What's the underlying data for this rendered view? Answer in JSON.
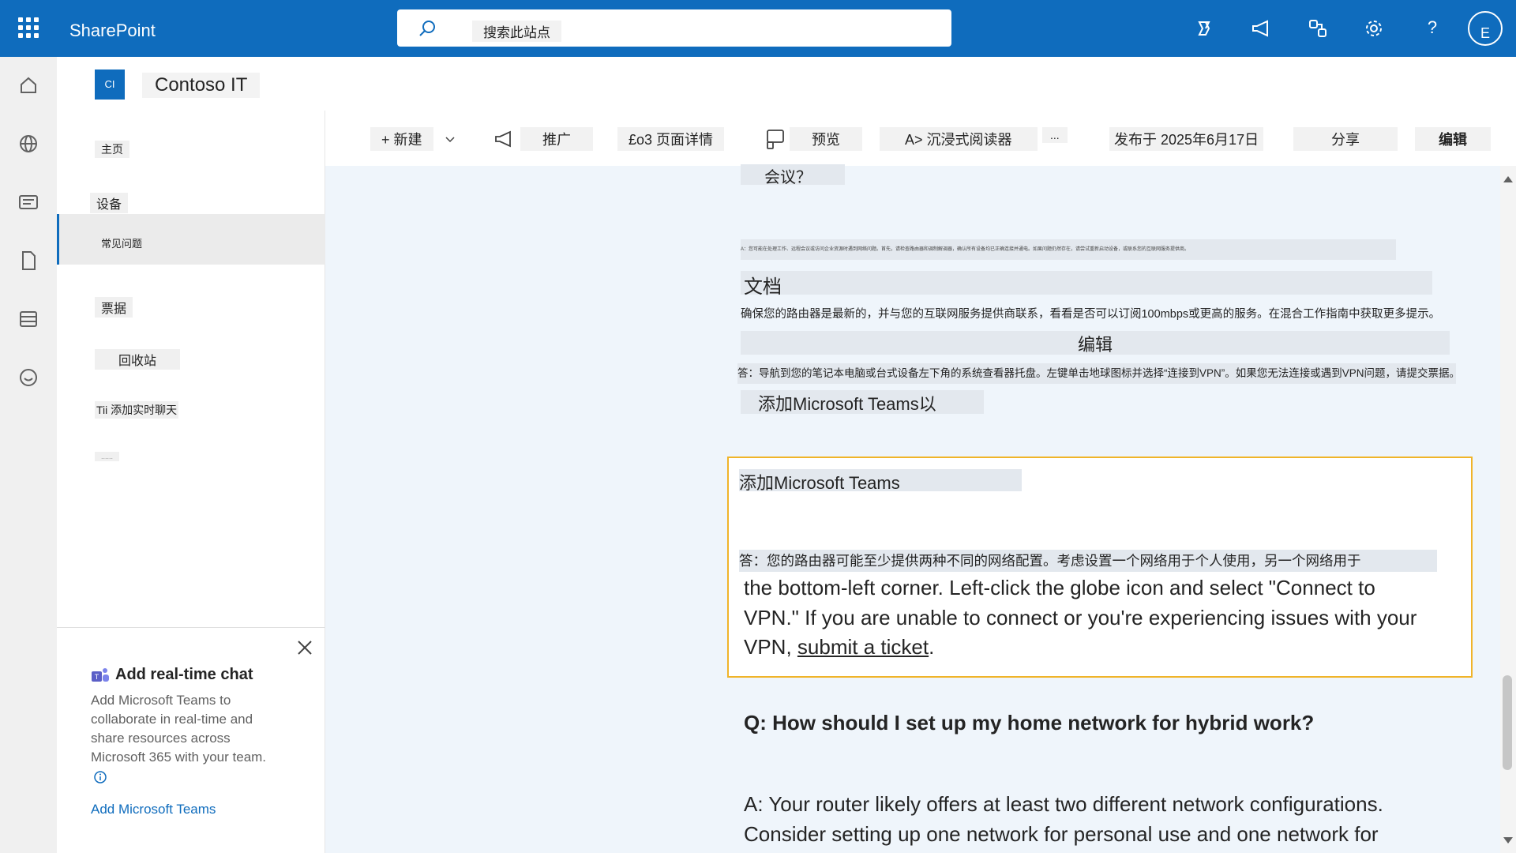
{
  "suitebar": {
    "brand": "SharePoint",
    "search_placeholder": "搜索此站点",
    "avatar_initial": "E",
    "help": "?"
  },
  "site": {
    "logo_text": "CI",
    "name": "Contoso IT"
  },
  "nav": {
    "items": [
      {
        "label": "主页"
      },
      {
        "label": "设备"
      },
      {
        "label": "常见问题"
      },
      {
        "label": "票据"
      },
      {
        "label": "回收站"
      },
      {
        "label": "Tii 添加实时聊天"
      },
      {
        "label": "......"
      }
    ]
  },
  "chat_panel": {
    "title": "Add real-time chat",
    "body": "Add Microsoft Teams to collaborate in real-time and share resources across Microsoft 365 with your team.",
    "link": "Add Microsoft Teams"
  },
  "cmdbar": {
    "new": "+ 新建",
    "promote": "推广",
    "page_details": "£o3 页面详情",
    "preview": "预览",
    "immersive": "A> 沉浸式阅读器",
    "more": "...",
    "published": "发布于 2025年6月17日",
    "share": "分享",
    "edit": "编辑"
  },
  "content": {
    "q_meeting": "会议？",
    "tiny_text": "A：您可能在处理工作、远程会议或访问企业资源时遇到网络问题。首先，请检查路由器和调制解调器，确认所有设备均已正确连接并通电。如果问题仍然存在，请尝试重新启动设备，或联系您的互联网服务提供商。",
    "doc_heading": "文档",
    "router_line": "确保您的路由器是最新的，并与您的互联网服务提供商联系，看看是否可以订阅100mbps或更高的服务。在混合工作指南中获取更多提示。",
    "edit_heading": "编辑",
    "vpn_line": "答：导航到您的笔记本电脑或台式设备左下角的系统查看器托盘。左键单击地球图标并选择“连接到VPN”。如果您无法连接或遇到VPN问题，请提交票据。",
    "add_teams_short": "添加Microsoft Teams以",
    "box_heading": "添加Microsoft Teams",
    "box_zh": "答：您的路由器可能至少提供两种不同的网络配置。考虑设置一个网络用于个人使用，另一个网络用于",
    "box_en_1": "the bottom-left corner. Left-click the globe icon and select \"Connect to",
    "box_en_2": "VPN.\" If you are unable to connect or you're experiencing issues with your",
    "box_en_3_pre": "VPN, ",
    "box_en_3_link": "submit a ticket",
    "box_en_3_post": ".",
    "q_home": "Q: How should I set up my home network for hybrid work?",
    "a_home_1": "A: Your router likely offers at least two different network configurations.",
    "a_home_2": "Consider setting up one network for personal use and one network for"
  }
}
